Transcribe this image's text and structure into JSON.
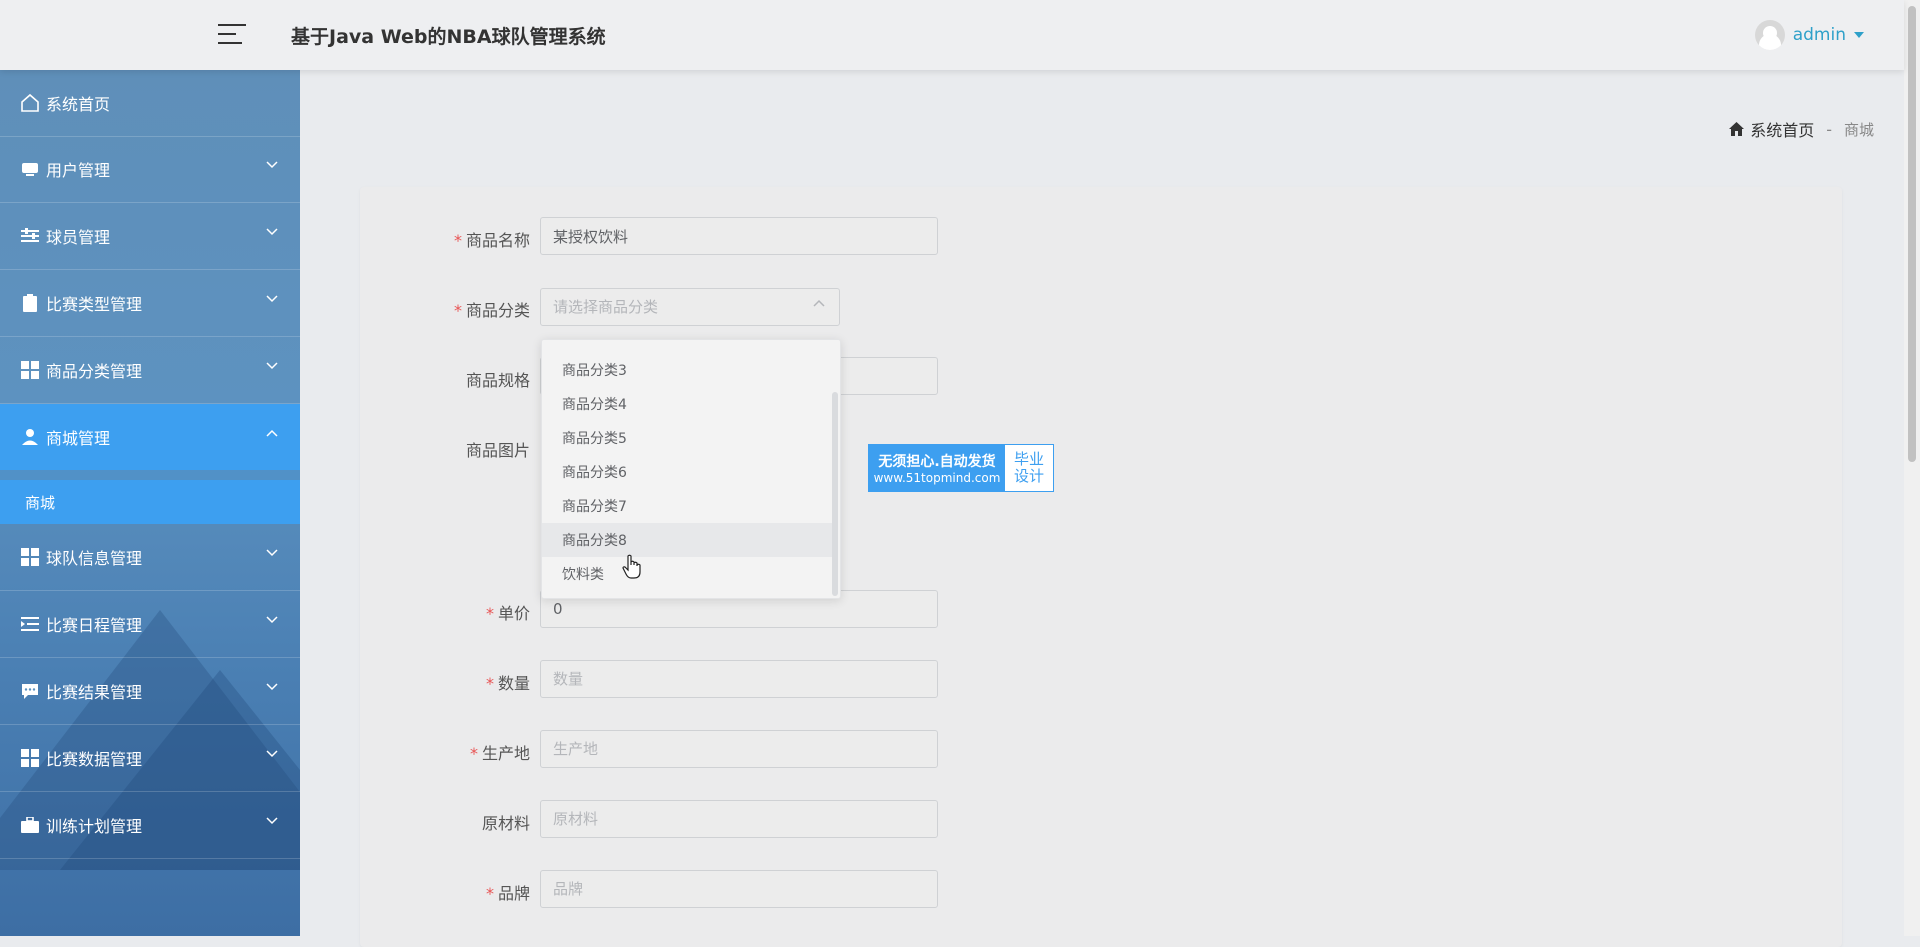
{
  "header": {
    "title": "基于Java Web的NBA球队管理系统",
    "username": "admin"
  },
  "sidebar": {
    "items": [
      {
        "label": "系统首页",
        "icon": "home-icon"
      },
      {
        "label": "用户管理",
        "icon": "user-card-icon"
      },
      {
        "label": "球员管理",
        "icon": "sliders-icon"
      },
      {
        "label": "比赛类型管理",
        "icon": "clipboard-icon"
      },
      {
        "label": "商品分类管理",
        "icon": "grid-icon"
      },
      {
        "label": "商城管理",
        "icon": "user-icon"
      },
      {
        "label": "球队信息管理",
        "icon": "grid-icon"
      },
      {
        "label": "比赛日程管理",
        "icon": "list-indent-icon"
      },
      {
        "label": "比赛结果管理",
        "icon": "comment-icon"
      },
      {
        "label": "比赛数据管理",
        "icon": "grid-icon"
      },
      {
        "label": "训练计划管理",
        "icon": "briefcase-icon"
      }
    ],
    "submenu_label": "商城"
  },
  "breadcrumb": {
    "home": "系统首页",
    "separator": "-",
    "current": "商城"
  },
  "form": {
    "name": {
      "label": "商品名称",
      "value": "某授权饮料"
    },
    "category": {
      "label": "商品分类",
      "placeholder": "请选择商品分类"
    },
    "spec": {
      "label": "商品规格"
    },
    "image": {
      "label": "商品图片"
    },
    "price": {
      "label": "单价",
      "value": "0"
    },
    "quantity": {
      "label": "数量",
      "placeholder": "数量"
    },
    "origin": {
      "label": "生产地",
      "placeholder": "生产地"
    },
    "material": {
      "label": "原材料",
      "placeholder": "原材料"
    },
    "brand": {
      "label": "品牌",
      "placeholder": "品牌"
    }
  },
  "dropdown": {
    "options": [
      "商品分类3",
      "商品分类4",
      "商品分类5",
      "商品分类6",
      "商品分类7",
      "商品分类8",
      "饮料类"
    ]
  },
  "banner": {
    "line1": "无须担心.自动发货",
    "line2": "www.51topmind.com",
    "right1": "毕业",
    "right2": "设计"
  },
  "colors": {
    "accent": "#3d9ff0",
    "required": "#e85454",
    "username": "#2ea0c9"
  }
}
